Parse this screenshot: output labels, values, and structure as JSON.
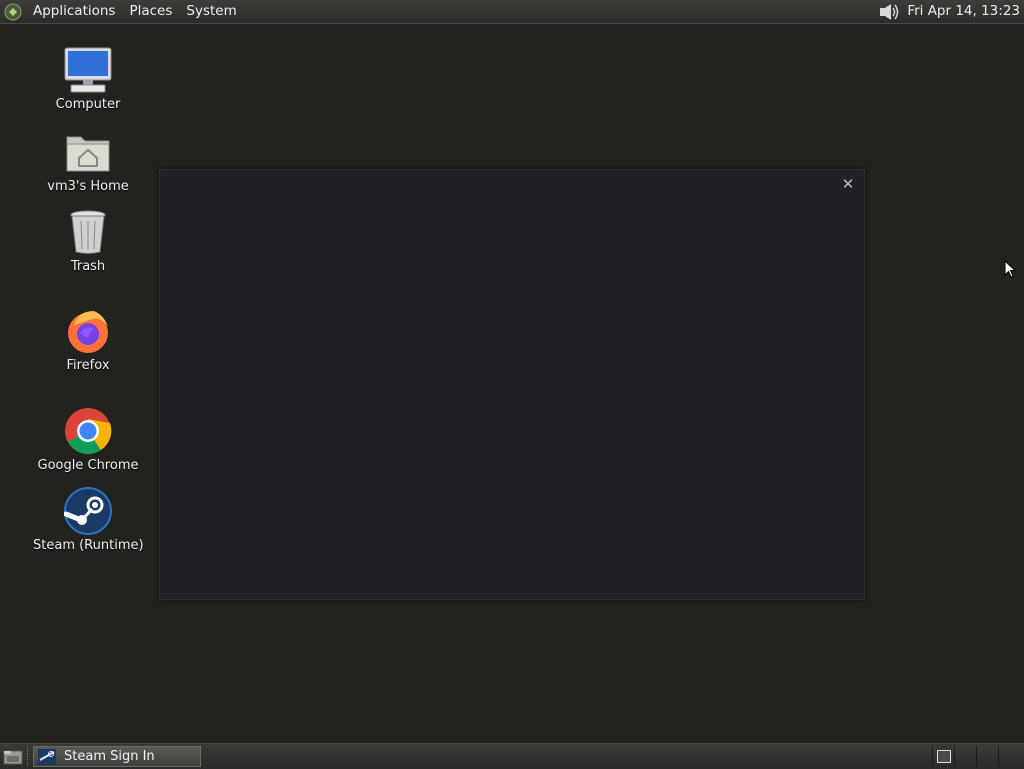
{
  "top_panel": {
    "menus": [
      "Applications",
      "Places",
      "System"
    ],
    "clock": "Fri Apr 14, 13:23",
    "icons": {
      "logo": "gnome-foot-icon",
      "volume": "speaker-volume-icon"
    }
  },
  "desktop": {
    "icons": [
      {
        "label": "Computer",
        "icon": "computer-monitor-icon"
      },
      {
        "label": "vm3's Home",
        "icon": "home-folder-icon"
      },
      {
        "label": "Trash",
        "icon": "trash-can-icon"
      },
      {
        "label": "Firefox",
        "icon": "firefox-icon"
      },
      {
        "label": "Google Chrome",
        "icon": "chrome-icon"
      },
      {
        "label": "Steam (Runtime)",
        "icon": "steam-icon"
      }
    ]
  },
  "dialog": {
    "close_glyph": "✕"
  },
  "bottom_panel": {
    "task_label": "Steam Sign In",
    "icons": {
      "show_desktop": "show-desktop-icon",
      "task": "steam-icon"
    }
  },
  "colors": {
    "desktop_bg": "#22221f",
    "dialog_bg": "#1f2126",
    "panel_bg": "#2c2c2a"
  }
}
